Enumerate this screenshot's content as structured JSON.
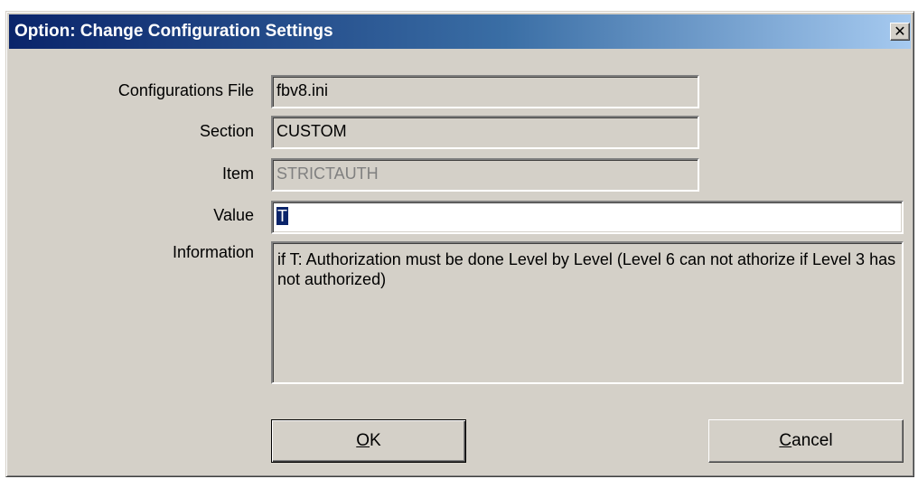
{
  "window": {
    "title": "Option: Change Configuration Settings",
    "close_label": "✕"
  },
  "form": {
    "config_file_label": "Configurations File",
    "config_file_value": "fbv8.ini",
    "section_label": "Section",
    "section_value": "CUSTOM",
    "item_label": "Item",
    "item_value": "STRICTAUTH",
    "value_label": "Value",
    "value_value": "T",
    "information_label": "Information",
    "information_text": "if T: Authorization must be done Level by Level (Level 6 can not athorize if Level 3 has not authorized)"
  },
  "buttons": {
    "ok_mnemonic": "O",
    "ok_rest": "K",
    "cancel_mnemonic": "C",
    "cancel_rest": "ancel"
  },
  "colors": {
    "titlebar_start": "#0a246a",
    "titlebar_end": "#a6caf0",
    "dialog_face": "#d4d0c8",
    "selection": "#0a246a"
  }
}
